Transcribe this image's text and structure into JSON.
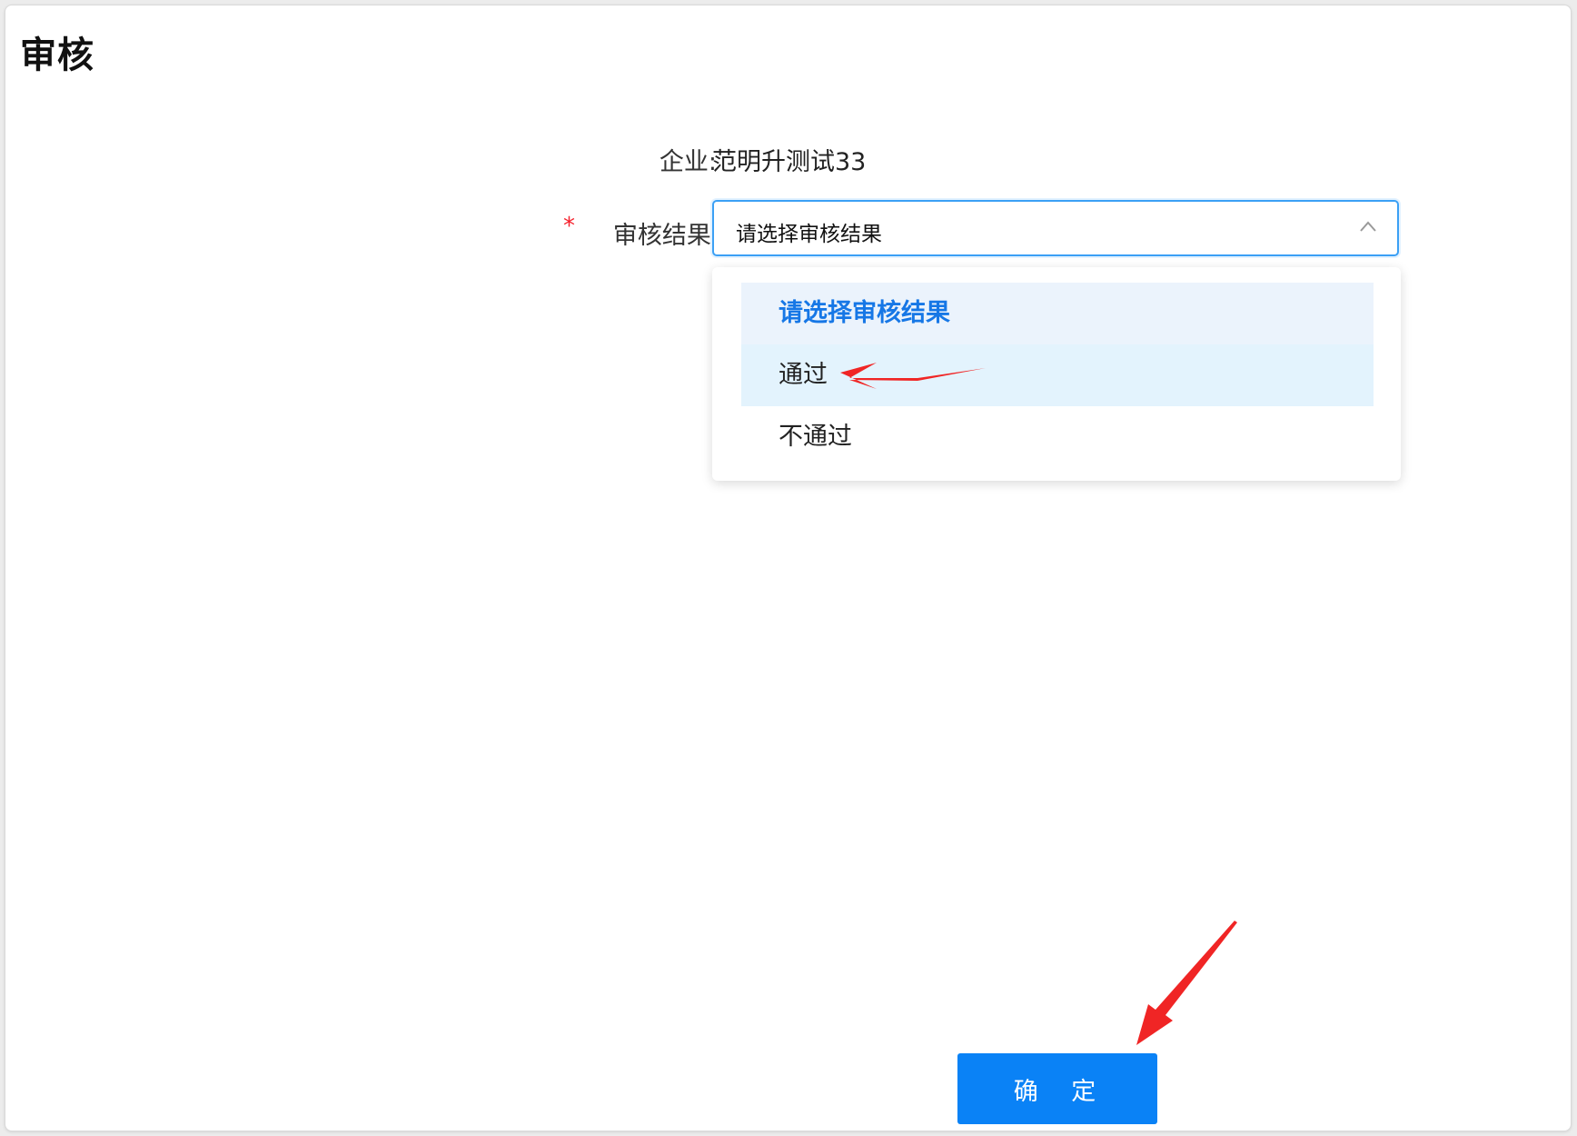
{
  "page": {
    "title": "审核"
  },
  "form": {
    "company_label": "企业:",
    "company_value": "范明升测试33",
    "result_required_mark": "*",
    "result_label": "审核结果:",
    "result_select": {
      "value": "请选择审核结果",
      "expanded": true,
      "options": [
        {
          "label": "请选择审核结果",
          "selected": true
        },
        {
          "label": "通过",
          "hovered": true
        },
        {
          "label": "不通过"
        }
      ]
    }
  },
  "actions": {
    "confirm_label": "确 定"
  },
  "colors": {
    "primary": "#0a82f6",
    "selected_option_text": "#1677e6",
    "required": "#f5222d",
    "annotation_arrow": "#f02525"
  },
  "icons": {
    "select_arrow": "chevron-up-icon",
    "annotations": [
      "red-arrow-pointing-to-option-pass",
      "red-arrow-pointing-to-confirm-button"
    ]
  }
}
